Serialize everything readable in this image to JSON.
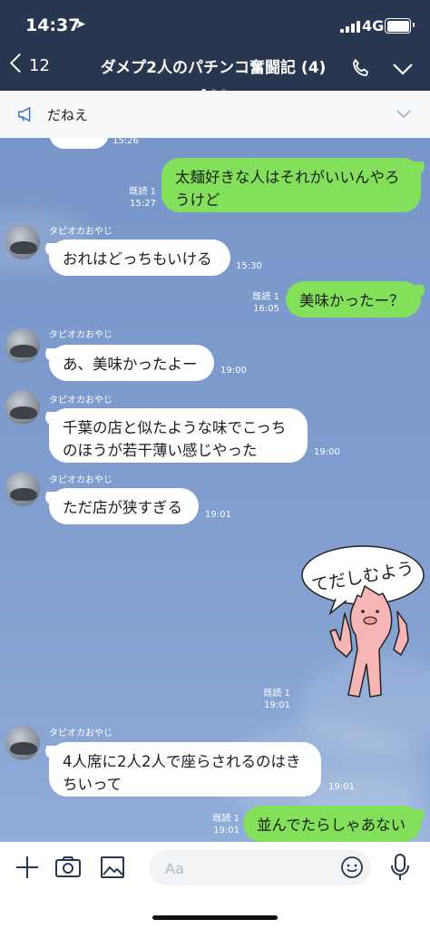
{
  "status_bar": {
    "time": "14:37",
    "network": "4G"
  },
  "header": {
    "back_count": "12",
    "title": "ダメプ2人のパチンコ奮闘記 (4)"
  },
  "announcement": {
    "text": "だねえ"
  },
  "messages": [
    {
      "dir": "in",
      "sender": "",
      "text": "",
      "time": "15:26"
    },
    {
      "dir": "out",
      "read": "既読 1",
      "time": "15:27",
      "lines": [
        "太麺好きな人はそれがいいんやろ",
        "うけど"
      ]
    },
    {
      "dir": "in",
      "sender": "タピオカおやじ",
      "time": "15:30",
      "lines": [
        "おれはどっちもいける"
      ]
    },
    {
      "dir": "out",
      "read": "既読 1",
      "time": "16:05",
      "lines": [
        "美味かったー？"
      ]
    },
    {
      "dir": "in",
      "sender": "タピオカおやじ",
      "time": "19:00",
      "lines": [
        "あ、美味かったよー"
      ]
    },
    {
      "dir": "in",
      "sender": "タピオカおやじ",
      "time": "19:00",
      "lines": [
        "千葉の店と似たような味でこっち",
        "のほうが若干薄い感じやった"
      ]
    },
    {
      "dir": "in",
      "sender": "タピオカおやじ",
      "time": "19:01",
      "lines": [
        "ただ店が狭すぎる"
      ]
    },
    {
      "dir": "out",
      "read": "既読 1",
      "time": "19:01",
      "sticker_text": "てだしむよう"
    },
    {
      "dir": "in",
      "sender": "タピオカおやじ",
      "time": "19:01",
      "lines": [
        "4人席に2人2人で座らされるのはき",
        "ちいって"
      ]
    },
    {
      "dir": "out",
      "read": "既読 1",
      "time": "19:01",
      "lines": [
        "並んでたらしゃあない"
      ]
    }
  ],
  "composer": {
    "placeholder": "Aa"
  },
  "colors": {
    "header": "#283650",
    "chat_bg": "#7d9bcd",
    "out_bubble": "#82e05b",
    "in_bubble": "#ffffff"
  },
  "icons": [
    "location-arrow-icon",
    "signal-icon",
    "battery-icon",
    "back-chevron-icon",
    "phone-icon",
    "chevron-down-icon",
    "megaphone-icon",
    "plus-icon",
    "camera-icon",
    "image-icon",
    "emoji-icon",
    "microphone-icon"
  ]
}
